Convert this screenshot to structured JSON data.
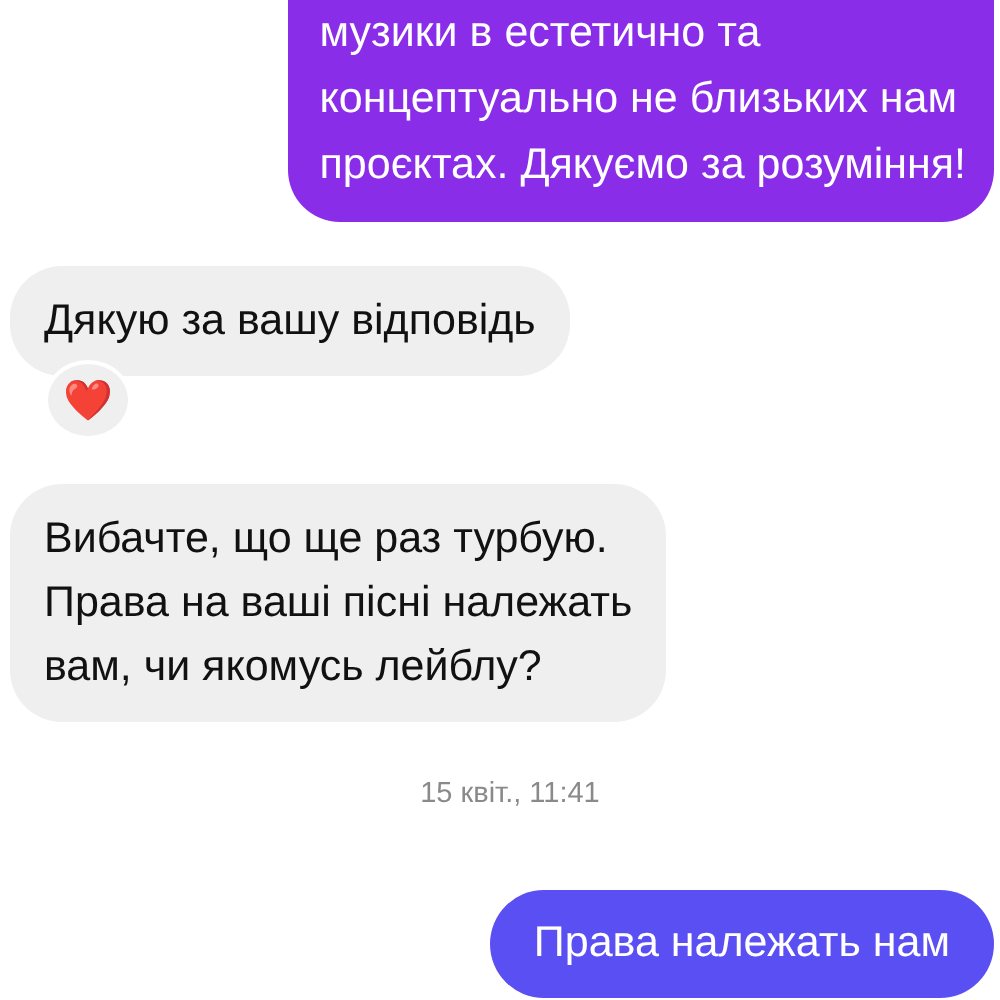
{
  "messages": [
    {
      "kind": "sent",
      "lines": [
        "музики в естетично та",
        "концептуально не близьких нам",
        "проєктах. Дякуємо за розуміння!"
      ],
      "color": "#8a2de8"
    },
    {
      "kind": "received",
      "lines": [
        "Дякую за вашу відповідь"
      ],
      "reaction": "❤️"
    },
    {
      "kind": "received",
      "lines": [
        "Вибачте, що ще раз турбую.",
        "Права на ваші пісні належать",
        "вам, чи якомусь лейблу?"
      ]
    },
    {
      "kind": "time",
      "text": "15 квіт., 11:41"
    },
    {
      "kind": "sent",
      "lines": [
        "Права належать нам"
      ],
      "color": "#5a4ff3"
    }
  ]
}
